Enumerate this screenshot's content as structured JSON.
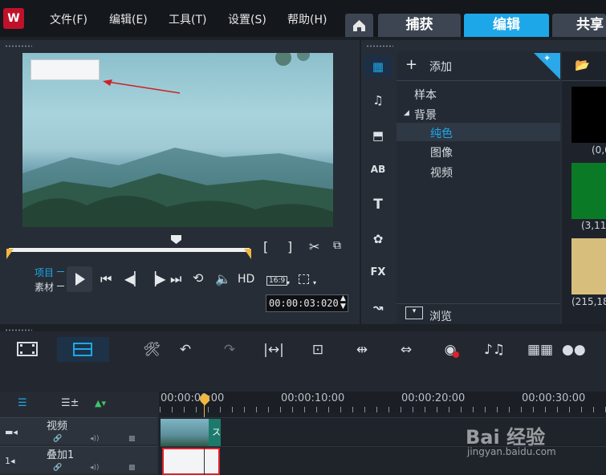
{
  "menu": [
    "文件(F)",
    "编辑(E)",
    "工具(T)",
    "设置(S)",
    "帮助(H)"
  ],
  "tabs": [
    "捕获",
    "编辑",
    "共享"
  ],
  "active_tab": "编辑",
  "colors": {
    "accent": "#1ea7e8",
    "tab_inactive": "#3d4552",
    "panel": "#272d36",
    "brand": "#c0112a"
  },
  "player": {
    "mode_labels": [
      "项目",
      "素材"
    ],
    "hd_label": "HD",
    "aspect_label": "16:9",
    "timecode": "00:00:03:020"
  },
  "library": {
    "add_label": "添加",
    "tree": [
      "样本",
      "背景",
      "纯色",
      "图像",
      "视频"
    ],
    "selected": "纯色",
    "browse_label": "浏览",
    "side_icons": [
      "media-icon",
      "audio-icon",
      "transition-icon",
      "title-ab-icon",
      "text-icon",
      "graphics-icon",
      "fx-icon",
      "path-icon"
    ],
    "fx_label": "FX",
    "ab_label": "AB",
    "t_label": "T",
    "thumbs": [
      {
        "color": "#000000",
        "caption": "(0,0"
      },
      {
        "color": "#0b7a26",
        "caption": "(3,11"
      },
      {
        "color": "#d8be7c",
        "caption": "(215,18"
      }
    ]
  },
  "timeline": {
    "ruler": [
      "00:00:00:00",
      "00:00:10:00",
      "00:00:20:00",
      "00:00:30:00"
    ],
    "tracks": [
      {
        "label": "视频"
      },
      {
        "label": "叠加1"
      }
    ]
  },
  "watermark": {
    "main": "Bai 经验",
    "sub": "jingyan.baidu.com"
  }
}
